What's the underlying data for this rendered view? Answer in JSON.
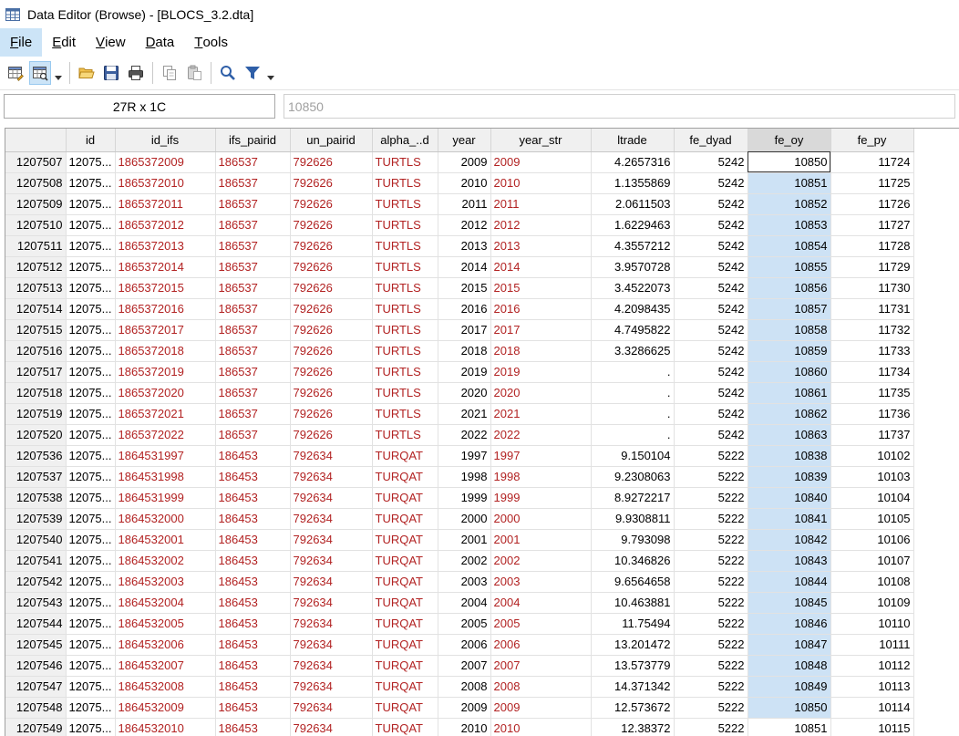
{
  "window": {
    "title": "Data Editor (Browse) - [BLOCS_3.2.dta]"
  },
  "menu": [
    {
      "label": "File",
      "key": "F",
      "rest": "ile",
      "active": true
    },
    {
      "label": "Edit",
      "key": "E",
      "rest": "dit",
      "active": false
    },
    {
      "label": "View",
      "key": "V",
      "rest": "iew",
      "active": false
    },
    {
      "label": "Data",
      "key": "D",
      "rest": "ata",
      "active": false
    },
    {
      "label": "Tools",
      "key": "T",
      "rest": "ools",
      "active": false
    }
  ],
  "toolbar": {
    "icons": [
      "data-editor-edit-icon",
      "data-editor-browse-icon",
      "open-folder-icon",
      "save-icon",
      "print-icon",
      "copy-icon",
      "paste-icon",
      "find-icon",
      "filter-icon"
    ]
  },
  "cellbar": {
    "name_box": "27R x 1C",
    "value": "10850"
  },
  "columns": [
    "",
    "id",
    "id_ifs",
    "ifs_pairid",
    "un_pairid",
    "alpha_..d",
    "year",
    "year_str",
    "ltrade",
    "fe_dyad",
    "fe_oy",
    "fe_py"
  ],
  "rows": [
    [
      "1207507",
      "12075...",
      "1865372009",
      "186537",
      "792626",
      "TURTLS",
      "2009",
      "2009",
      "4.2657316",
      "5242",
      "10850",
      "11724"
    ],
    [
      "1207508",
      "12075...",
      "1865372010",
      "186537",
      "792626",
      "TURTLS",
      "2010",
      "2010",
      "1.1355869",
      "5242",
      "10851",
      "11725"
    ],
    [
      "1207509",
      "12075...",
      "1865372011",
      "186537",
      "792626",
      "TURTLS",
      "2011",
      "2011",
      "2.0611503",
      "5242",
      "10852",
      "11726"
    ],
    [
      "1207510",
      "12075...",
      "1865372012",
      "186537",
      "792626",
      "TURTLS",
      "2012",
      "2012",
      "1.6229463",
      "5242",
      "10853",
      "11727"
    ],
    [
      "1207511",
      "12075...",
      "1865372013",
      "186537",
      "792626",
      "TURTLS",
      "2013",
      "2013",
      "4.3557212",
      "5242",
      "10854",
      "11728"
    ],
    [
      "1207512",
      "12075...",
      "1865372014",
      "186537",
      "792626",
      "TURTLS",
      "2014",
      "2014",
      "3.9570728",
      "5242",
      "10855",
      "11729"
    ],
    [
      "1207513",
      "12075...",
      "1865372015",
      "186537",
      "792626",
      "TURTLS",
      "2015",
      "2015",
      "3.4522073",
      "5242",
      "10856",
      "11730"
    ],
    [
      "1207514",
      "12075...",
      "1865372016",
      "186537",
      "792626",
      "TURTLS",
      "2016",
      "2016",
      "4.2098435",
      "5242",
      "10857",
      "11731"
    ],
    [
      "1207515",
      "12075...",
      "1865372017",
      "186537",
      "792626",
      "TURTLS",
      "2017",
      "2017",
      "4.7495822",
      "5242",
      "10858",
      "11732"
    ],
    [
      "1207516",
      "12075...",
      "1865372018",
      "186537",
      "792626",
      "TURTLS",
      "2018",
      "2018",
      "3.3286625",
      "5242",
      "10859",
      "11733"
    ],
    [
      "1207517",
      "12075...",
      "1865372019",
      "186537",
      "792626",
      "TURTLS",
      "2019",
      "2019",
      ".",
      "5242",
      "10860",
      "11734"
    ],
    [
      "1207518",
      "12075...",
      "1865372020",
      "186537",
      "792626",
      "TURTLS",
      "2020",
      "2020",
      ".",
      "5242",
      "10861",
      "11735"
    ],
    [
      "1207519",
      "12075...",
      "1865372021",
      "186537",
      "792626",
      "TURTLS",
      "2021",
      "2021",
      ".",
      "5242",
      "10862",
      "11736"
    ],
    [
      "1207520",
      "12075...",
      "1865372022",
      "186537",
      "792626",
      "TURTLS",
      "2022",
      "2022",
      ".",
      "5242",
      "10863",
      "11737"
    ],
    [
      "1207536",
      "12075...",
      "1864531997",
      "186453",
      "792634",
      "TURQAT",
      "1997",
      "1997",
      "9.150104",
      "5222",
      "10838",
      "10102"
    ],
    [
      "1207537",
      "12075...",
      "1864531998",
      "186453",
      "792634",
      "TURQAT",
      "1998",
      "1998",
      "9.2308063",
      "5222",
      "10839",
      "10103"
    ],
    [
      "1207538",
      "12075...",
      "1864531999",
      "186453",
      "792634",
      "TURQAT",
      "1999",
      "1999",
      "8.9272217",
      "5222",
      "10840",
      "10104"
    ],
    [
      "1207539",
      "12075...",
      "1864532000",
      "186453",
      "792634",
      "TURQAT",
      "2000",
      "2000",
      "9.9308811",
      "5222",
      "10841",
      "10105"
    ],
    [
      "1207540",
      "12075...",
      "1864532001",
      "186453",
      "792634",
      "TURQAT",
      "2001",
      "2001",
      "9.793098",
      "5222",
      "10842",
      "10106"
    ],
    [
      "1207541",
      "12075...",
      "1864532002",
      "186453",
      "792634",
      "TURQAT",
      "2002",
      "2002",
      "10.346826",
      "5222",
      "10843",
      "10107"
    ],
    [
      "1207542",
      "12075...",
      "1864532003",
      "186453",
      "792634",
      "TURQAT",
      "2003",
      "2003",
      "9.6564658",
      "5222",
      "10844",
      "10108"
    ],
    [
      "1207543",
      "12075...",
      "1864532004",
      "186453",
      "792634",
      "TURQAT",
      "2004",
      "2004",
      "10.463881",
      "5222",
      "10845",
      "10109"
    ],
    [
      "1207544",
      "12075...",
      "1864532005",
      "186453",
      "792634",
      "TURQAT",
      "2005",
      "2005",
      "11.75494",
      "5222",
      "10846",
      "10110"
    ],
    [
      "1207545",
      "12075...",
      "1864532006",
      "186453",
      "792634",
      "TURQAT",
      "2006",
      "2006",
      "13.201472",
      "5222",
      "10847",
      "10111"
    ],
    [
      "1207546",
      "12075...",
      "1864532007",
      "186453",
      "792634",
      "TURQAT",
      "2007",
      "2007",
      "13.573779",
      "5222",
      "10848",
      "10112"
    ],
    [
      "1207547",
      "12075...",
      "1864532008",
      "186453",
      "792634",
      "TURQAT",
      "2008",
      "2008",
      "14.371342",
      "5222",
      "10849",
      "10113"
    ],
    [
      "1207548",
      "12075...",
      "1864532009",
      "186453",
      "792634",
      "TURQAT",
      "2009",
      "2009",
      "12.573672",
      "5222",
      "10850",
      "10114"
    ],
    [
      "1207549",
      "12075...",
      "1864532010",
      "186453",
      "792634",
      "TURQAT",
      "2010",
      "2010",
      "12.38372",
      "5222",
      "10851",
      "10115"
    ]
  ],
  "selection": {
    "column": "fe_oy",
    "selected_rows": 27,
    "current_row": 0
  },
  "colors": {
    "string_text": "#b22222",
    "selection": "#cde2f5",
    "header_bg": "#f0f0f0",
    "menu_active": "#cce4f7",
    "frozen_divider": "#e3393a"
  }
}
